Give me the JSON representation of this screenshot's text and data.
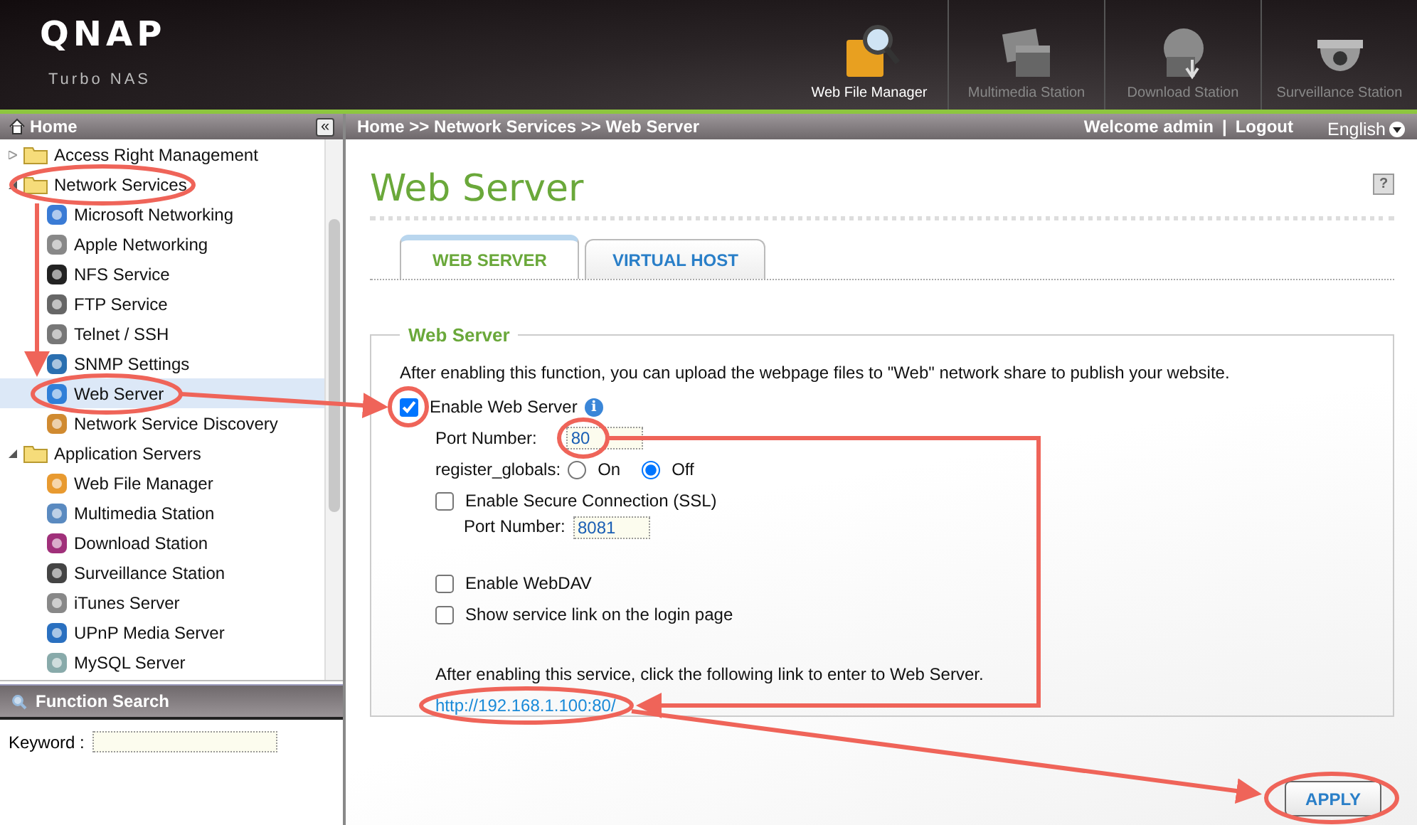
{
  "header": {
    "logo": "QNAP",
    "subtitle": "Turbo NAS",
    "apps": [
      {
        "label": "Web File Manager",
        "selected": true
      },
      {
        "label": "Multimedia Station",
        "selected": false
      },
      {
        "label": "Download Station",
        "selected": false
      },
      {
        "label": "Surveillance Station",
        "selected": false
      }
    ]
  },
  "sidebar": {
    "title": "Home",
    "collapse_icon": "«",
    "tree": [
      {
        "label": "Access Right Management",
        "expanded": false,
        "selected": false
      },
      {
        "label": "Network Services",
        "expanded": true,
        "selected": false,
        "children": [
          {
            "label": "Microsoft Networking",
            "selected": false
          },
          {
            "label": "Apple Networking",
            "selected": false
          },
          {
            "label": "NFS Service",
            "selected": false
          },
          {
            "label": "FTP Service",
            "selected": false
          },
          {
            "label": "Telnet / SSH",
            "selected": false
          },
          {
            "label": "SNMP Settings",
            "selected": false
          },
          {
            "label": "Web Server",
            "selected": true
          },
          {
            "label": "Network Service Discovery",
            "selected": false
          }
        ]
      },
      {
        "label": "Application Servers",
        "expanded": true,
        "selected": false,
        "children": [
          {
            "label": "Web File Manager",
            "selected": false
          },
          {
            "label": "Multimedia Station",
            "selected": false
          },
          {
            "label": "Download Station",
            "selected": false
          },
          {
            "label": "Surveillance Station",
            "selected": false
          },
          {
            "label": "iTunes Server",
            "selected": false
          },
          {
            "label": "UPnP Media Server",
            "selected": false
          },
          {
            "label": "MySQL Server",
            "selected": false
          }
        ]
      }
    ],
    "search": {
      "title": "Function Search",
      "label": "Keyword :"
    }
  },
  "topbar": {
    "breadcrumb": "Home >> Network Services >> Web Server",
    "welcome": "Welcome admin",
    "separator": "|",
    "logout": "Logout",
    "language": "English"
  },
  "page": {
    "title": "Web Server",
    "help": "?",
    "tabs": [
      {
        "label": "WEB SERVER",
        "selected": true
      },
      {
        "label": "VIRTUAL HOST",
        "selected": false
      }
    ],
    "section": "Web Server",
    "intro": "After enabling this function, you can upload the webpage files to \"Web\" network share to publish your website.",
    "enable": {
      "label": "Enable Web Server",
      "checked": true,
      "info": "i"
    },
    "port": {
      "label": "Port Number:",
      "value": "80"
    },
    "register_globals": {
      "label": "register_globals:",
      "options": [
        {
          "label": "On",
          "selected": false
        },
        {
          "label": "Off",
          "selected": true
        }
      ]
    },
    "ssl": {
      "label": "Enable Secure Connection (SSL)",
      "checked": false
    },
    "ssl_port": {
      "label": "Port Number:",
      "value": "8081"
    },
    "webdav": {
      "label": "Enable WebDAV",
      "checked": false
    },
    "show_link": {
      "label": "Show service link on the login page",
      "checked": false
    },
    "link_note": "After enabling this service, click the following link to enter to Web Server.",
    "link": "http://192.168.1.100:80/",
    "apply": "APPLY"
  }
}
